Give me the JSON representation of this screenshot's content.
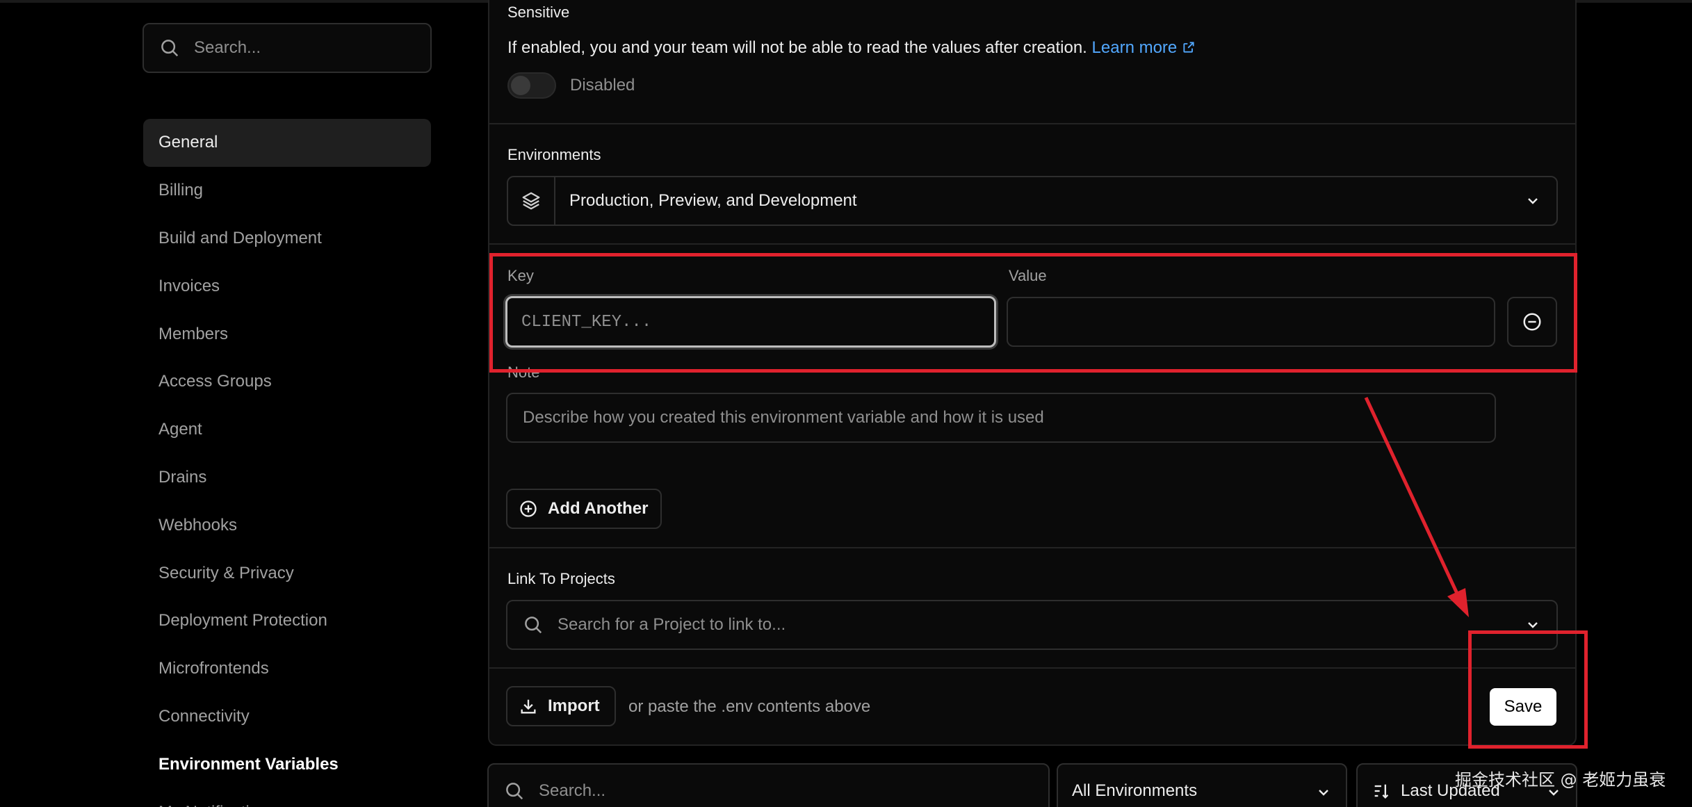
{
  "sidebar": {
    "search_placeholder": "Search...",
    "items": [
      {
        "label": "General"
      },
      {
        "label": "Billing"
      },
      {
        "label": "Build and Deployment"
      },
      {
        "label": "Invoices"
      },
      {
        "label": "Members"
      },
      {
        "label": "Access Groups"
      },
      {
        "label": "Agent"
      },
      {
        "label": "Drains"
      },
      {
        "label": "Webhooks"
      },
      {
        "label": "Security & Privacy"
      },
      {
        "label": "Deployment Protection"
      },
      {
        "label": "Microfrontends"
      },
      {
        "label": "Connectivity"
      },
      {
        "label": "Environment Variables"
      },
      {
        "label": "My Notifications"
      }
    ]
  },
  "form": {
    "sensitive_label": "Sensitive",
    "sensitive_desc": "If enabled, you and your team will not be able to read the values after creation.",
    "learn_more": "Learn more",
    "toggle_state": "Disabled",
    "environments_label": "Environments",
    "environments_value": "Production, Preview, and Development",
    "key_label": "Key",
    "key_placeholder": "CLIENT_KEY...",
    "value_label": "Value",
    "value_value": "",
    "note_label": "Note",
    "note_placeholder": "Describe how you created this environment variable and how it is used",
    "add_another": "Add Another",
    "link_projects_label": "Link To Projects",
    "project_search_placeholder": "Search for a Project to link to...",
    "import_label": "Import",
    "paste_hint": "or paste the .env contents above",
    "save_label": "Save"
  },
  "filters": {
    "search_placeholder": "Search...",
    "env_filter": "All Environments",
    "sort": "Last Updated"
  },
  "watermark": "掘金技术社区 @ 老姬力虽衰",
  "colors": {
    "background": "#000000",
    "card": "#0a0a0a",
    "border": "#2e2e2e",
    "link": "#52a8ff",
    "annotation": "#e0222d"
  }
}
